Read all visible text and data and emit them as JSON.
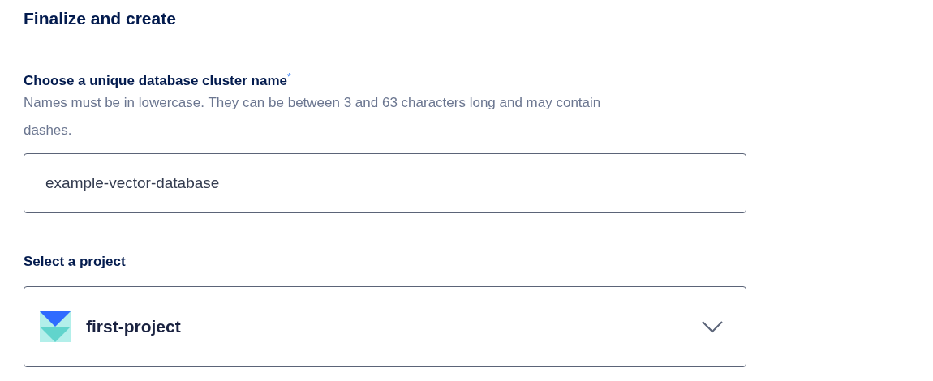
{
  "title": "Finalize and create",
  "name_field": {
    "label": "Choose a unique database cluster name",
    "required_mark": "*",
    "help": "Names must be in lowercase. They can be between 3 and 63 characters long and may contain dashes.",
    "value": "example-vector-database"
  },
  "project_select": {
    "label": "Select a project",
    "value": "first-project",
    "expanded": false
  }
}
